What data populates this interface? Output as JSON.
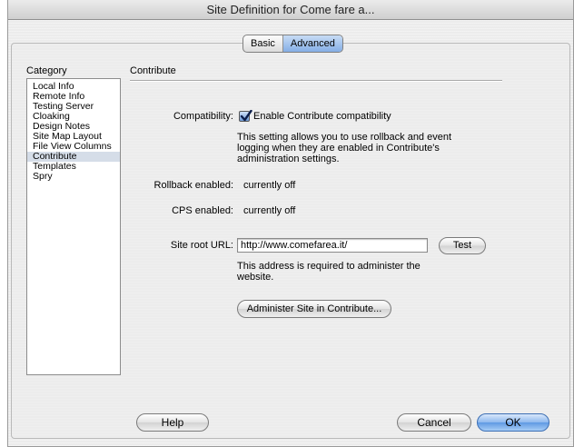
{
  "window": {
    "title": "Site Definition for Come fare a..."
  },
  "tabs": {
    "basic": "Basic",
    "advanced": "Advanced"
  },
  "category": {
    "label": "Category",
    "items": [
      "Local Info",
      "Remote Info",
      "Testing Server",
      "Cloaking",
      "Design Notes",
      "Site Map Layout",
      "File View Columns",
      "Contribute",
      "Templates",
      "Spry"
    ],
    "selected": "Contribute"
  },
  "section": {
    "title": "Contribute"
  },
  "compatibility": {
    "label": "Compatibility:",
    "checkbox_label": "Enable Contribute compatibility",
    "checked": true,
    "help": [
      "This setting allows you to use rollback and event",
      "logging when they are enabled in Contribute's",
      "administration settings."
    ]
  },
  "rollback": {
    "label": "Rollback enabled:",
    "value": "currently off"
  },
  "cps": {
    "label": "CPS enabled:",
    "value": "currently off"
  },
  "site_root": {
    "label": "Site root URL:",
    "value": "http://www.comefarea.it/",
    "test_button": "Test",
    "help": [
      "This address is required to administer the",
      "website."
    ]
  },
  "administer_button": "Administer Site in Contribute...",
  "footer": {
    "help": "Help",
    "cancel": "Cancel",
    "ok": "OK"
  },
  "colors": {
    "selected_row": "#d5dde8",
    "default_button": "#5d98e3"
  }
}
